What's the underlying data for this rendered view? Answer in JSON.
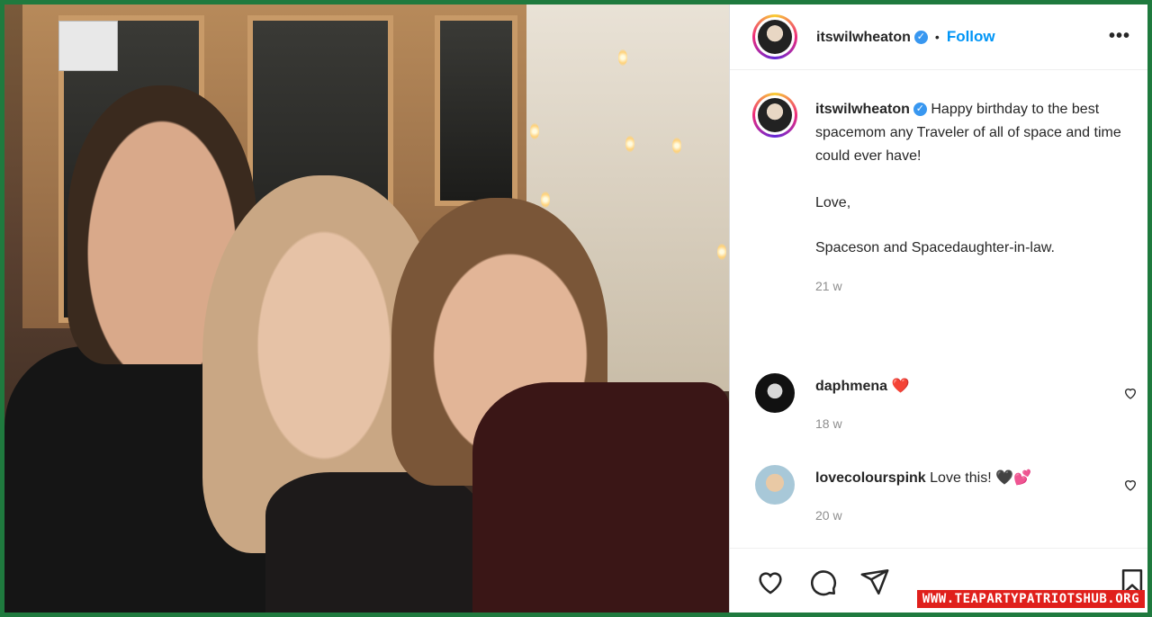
{
  "post": {
    "username": "itswilwheaton",
    "verified_icon": "verified-badge-icon",
    "separator": "•",
    "follow_label": "Follow",
    "more_label": "•••"
  },
  "caption": {
    "username": "itswilwheaton",
    "text": "Happy birthday to the best spacemom any Traveler of all of space and time could ever have!",
    "line2": "Love,",
    "line3": "Spaceson and Spacedaughter-in-law.",
    "time": "21 w"
  },
  "comments": [
    {
      "username": "daphmena",
      "text": "❤️",
      "time": "18 w"
    },
    {
      "username": "lovecolourspink",
      "text": "Love this! 🖤💕",
      "time": "20 w"
    }
  ],
  "actions": {
    "like_icon": "heart-icon",
    "comment_icon": "comment-icon",
    "share_icon": "share-icon",
    "save_icon": "bookmark-icon"
  },
  "watermark": "WWW.TEAPARTYPATRIOTSHUB.ORG",
  "colors": {
    "follow": "#0095f6",
    "verified": "#3897f0",
    "frame": "#1f7a3e",
    "watermark_bg": "#e0201c"
  }
}
